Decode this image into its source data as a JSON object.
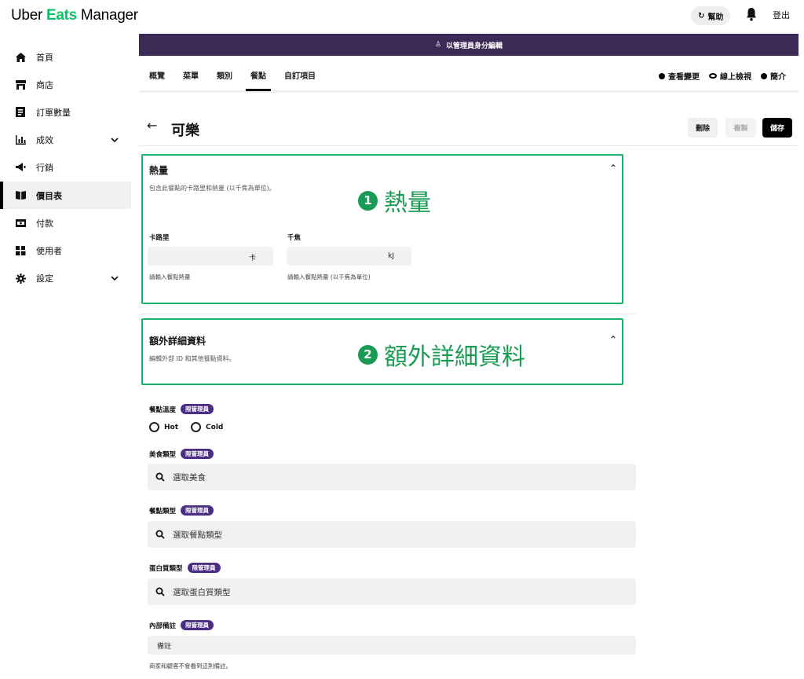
{
  "brand": {
    "uber": "Uber ",
    "eats": "Eats",
    "manager": " Manager"
  },
  "topbar": {
    "help_label": "幫助",
    "logout_label": "登出"
  },
  "sidebar": {
    "items": [
      {
        "label": "首頁",
        "icon": "home-icon"
      },
      {
        "label": "商店",
        "icon": "store-icon"
      },
      {
        "label": "訂單數量",
        "icon": "receipt-icon"
      },
      {
        "label": "成效",
        "icon": "bar-chart-icon"
      },
      {
        "label": "行銷",
        "icon": "megaphone-icon"
      },
      {
        "label": "價目表",
        "icon": "book-icon"
      },
      {
        "label": "付款",
        "icon": "wallet-icon"
      },
      {
        "label": "使用者",
        "icon": "users-icon"
      },
      {
        "label": "設定",
        "icon": "gear-icon"
      }
    ]
  },
  "admin_bar": {
    "label": "以管理員身分編輯"
  },
  "tabs": [
    "概覽",
    "菜單",
    "類別",
    "餐點",
    "自訂項目"
  ],
  "tab_actions": {
    "changes": "查看變更",
    "preview": "線上檢視",
    "intro": "簡介"
  },
  "page": {
    "title": "可樂",
    "delete": "刪除",
    "copy": "複製",
    "save": "儲存"
  },
  "energy": {
    "title": "熱量",
    "desc": "包含此餐點的卡路里和熱量 (以千焦為單位)。",
    "callout": "熱量",
    "callout_num": "1",
    "calories_label": "卡路里",
    "calories_unit": "卡",
    "calories_hint": "請輸入餐點熱量",
    "kj_label": "千焦",
    "kj_unit": "kJ",
    "kj_hint": "請輸入餐點熱量 (以千焦為單位)"
  },
  "extra": {
    "title": "額外詳細資料",
    "desc": "編輯外部 ID 和其他餐點資料。",
    "callout": "額外詳細資料",
    "callout_num": "2"
  },
  "admin_badge": "限管理員",
  "temperature": {
    "label": "餐點溫度",
    "hot": "Hot",
    "cold": "Cold"
  },
  "cuisine": {
    "label": "美食類型",
    "placeholder": "選取美食"
  },
  "dish_type": {
    "label": "餐點類型",
    "placeholder": "選取餐點類型"
  },
  "protein": {
    "label": "蛋白質類型",
    "placeholder": "選取蛋白質類型"
  },
  "notes": {
    "label": "內部備註",
    "placeholder": "備註",
    "hint": "商家和顧客不會看到這則備註。"
  },
  "colors": {
    "accent": "#06c167",
    "admin": "#3b2a55",
    "highlight": "#1ab16a"
  }
}
